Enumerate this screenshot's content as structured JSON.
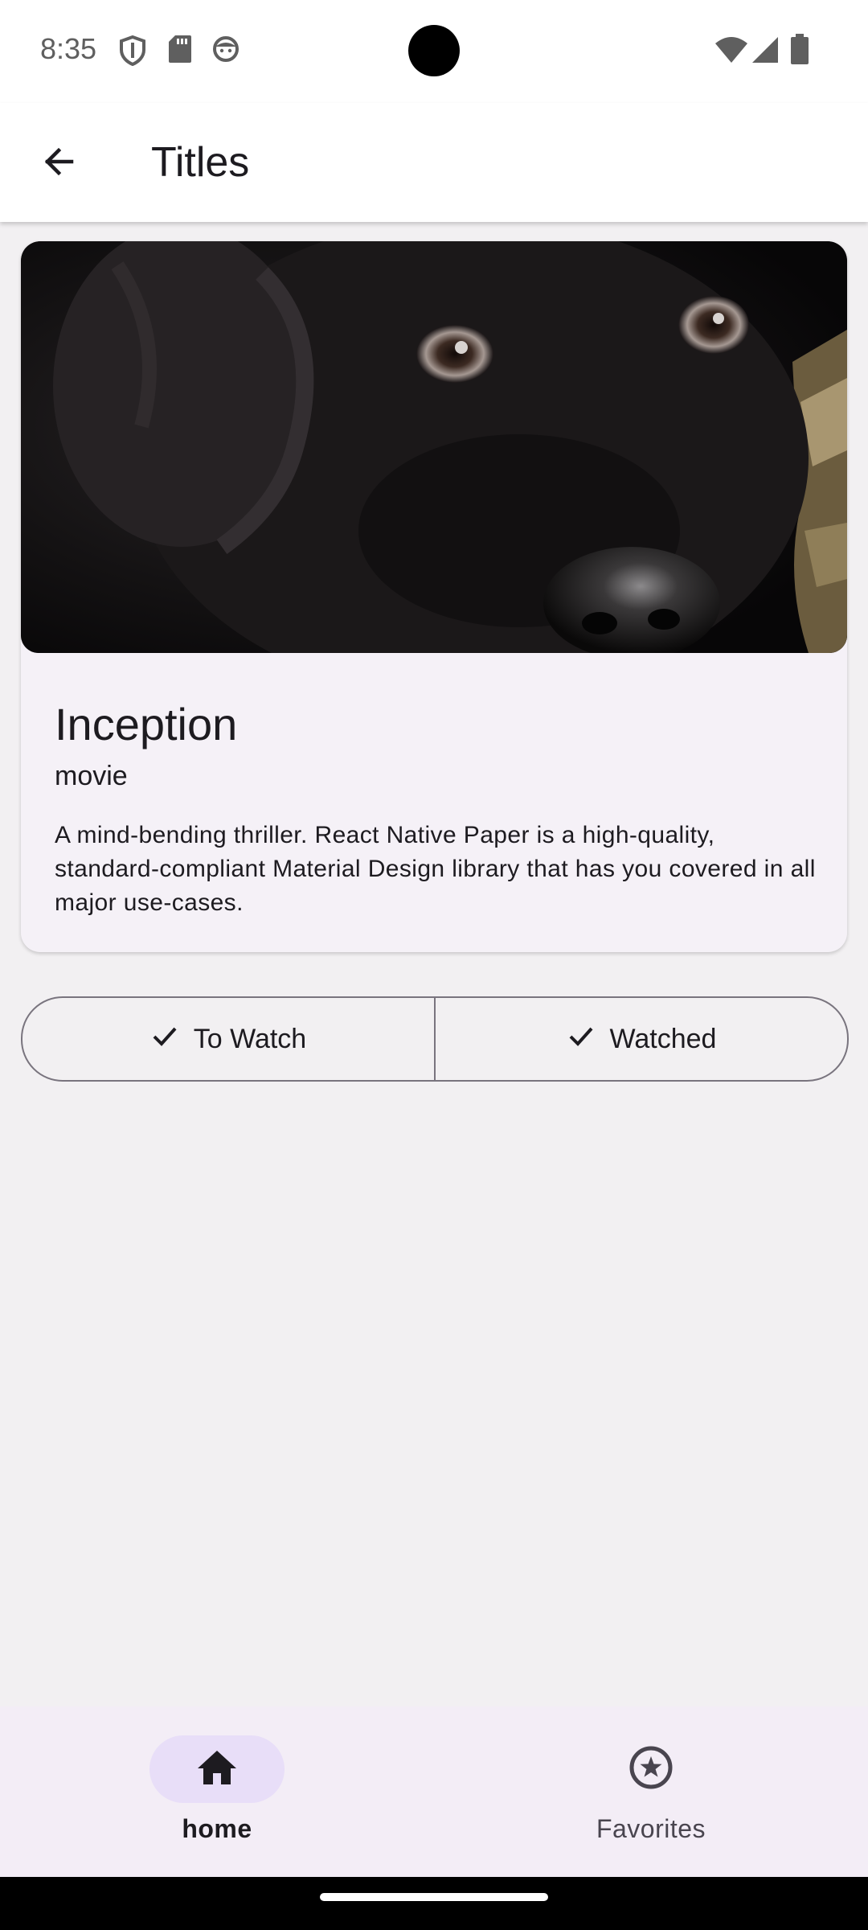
{
  "status_bar": {
    "time": "8:35",
    "icons": [
      "shield-icon",
      "sd-card-icon",
      "face-icon",
      "wifi-icon",
      "cell-signal-icon",
      "battery-icon"
    ]
  },
  "app_bar": {
    "back_icon": "arrow-back-icon",
    "title": "Titles"
  },
  "card": {
    "image": "black-dog-photo",
    "title": "Inception",
    "subtitle": "movie",
    "description": "A mind-bending thriller. React Native Paper is a high-quality, standard-compliant Material Design library that has you covered in all major use-cases."
  },
  "segmented_buttons": [
    {
      "label": "To Watch",
      "icon": "check-icon"
    },
    {
      "label": "Watched",
      "icon": "check-icon"
    }
  ],
  "bottom_nav": {
    "items": [
      {
        "label": "home",
        "icon": "home-icon",
        "active": true
      },
      {
        "label": "Favorites",
        "icon": "star-circle-icon",
        "active": false
      }
    ]
  },
  "colors": {
    "background": "#f2f0f2",
    "card": "#f5f1f7",
    "nav_background": "#f3edf6",
    "nav_active_pill": "#e8def8",
    "outline": "#79747e",
    "text": "#1d1b20"
  }
}
